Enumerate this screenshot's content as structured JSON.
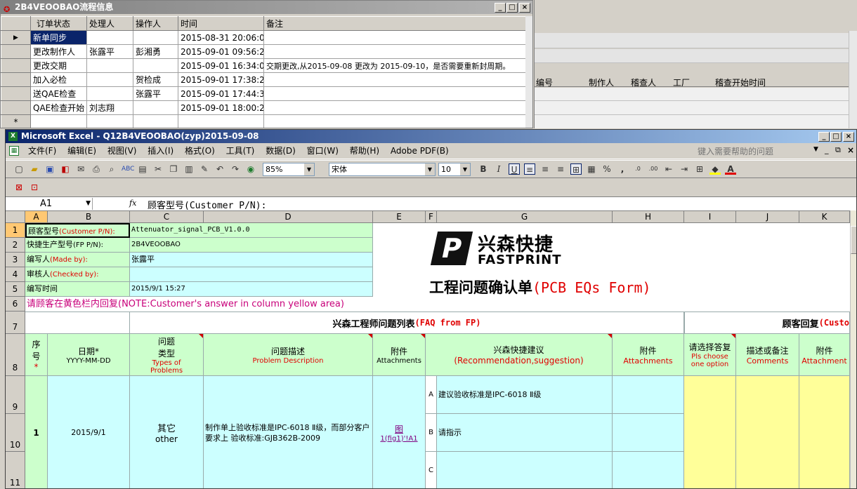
{
  "flow_window": {
    "title": "2B4VEOOBAO流程信息",
    "headers": [
      "订单状态",
      "处理人",
      "操作人",
      "时间",
      "备注"
    ],
    "rows": [
      {
        "status": "新单同步",
        "handler": "",
        "operator": "",
        "time": "2015-08-31 20:06:00",
        "note": ""
      },
      {
        "status": "更改制作人",
        "handler": "张露平",
        "operator": "彭湘勇",
        "time": "2015-09-01 09:56:28",
        "note": ""
      },
      {
        "status": "更改交期",
        "handler": "",
        "operator": "",
        "time": "2015-09-01 16:34:09",
        "note": "交期更改,从2015-09-08 更改为 2015-09-10，是否需要重新封周期。"
      },
      {
        "status": "加入必检",
        "handler": "",
        "operator": "贺检成",
        "time": "2015-09-01 17:38:20",
        "note": ""
      },
      {
        "status": "送QAE检查",
        "handler": "",
        "operator": "张露平",
        "time": "2015-09-01 17:44:38",
        "note": ""
      },
      {
        "status": "QAE检查开始",
        "handler": "刘志翔",
        "operator": "",
        "time": "2015-09-01 18:00:24",
        "note": ""
      }
    ],
    "new_row_marker": "*",
    "current_row_marker": "▶"
  },
  "back_window": {
    "headers": [
      "编号",
      "制作人",
      "稽查人",
      "工厂",
      "稽查开始时间"
    ]
  },
  "excel": {
    "title": "Microsoft Excel - Q12B4VEOOBAO(zyp)2015-09-08",
    "menu": [
      "文件(F)",
      "编辑(E)",
      "视图(V)",
      "插入(I)",
      "格式(O)",
      "工具(T)",
      "数据(D)",
      "窗口(W)",
      "帮助(H)",
      "Adobe PDF(B)"
    ],
    "help_placeholder": "键入需要帮助的问题",
    "zoom": "85%",
    "font": "宋体",
    "font_size": "10",
    "name_box": "A1",
    "fx": "fx",
    "formula": "顾客型号(Customer P/N):",
    "columns": [
      "A",
      "B",
      "C",
      "D",
      "E",
      "F",
      "G",
      "H",
      "I",
      "J",
      "K"
    ],
    "rows": [
      "1",
      "2",
      "3",
      "4",
      "5",
      "6",
      "7",
      "8",
      "9",
      "10",
      "11"
    ],
    "info": [
      {
        "label_cn": "顾客型号",
        "label_en": "(Customer P/N):",
        "value": "Attenuator_signal_PCB_V1.0.0"
      },
      {
        "label_cn": "快捷生产型号",
        "label_en": "(FP P/N):",
        "value": "2B4VEOOBAO"
      },
      {
        "label_cn": "编写人",
        "label_en": "(Made by):",
        "value": "张露平"
      },
      {
        "label_cn": "审核人",
        "label_en": "(Checked by):",
        "value": ""
      },
      {
        "label_cn": "编写时间",
        "label_en": "",
        "value": "2015/9/1 15:27"
      }
    ],
    "note_cn": "请顾客在黄色栏内回复",
    "note_en": "(NOTE:Customer's answer in column yellow area)",
    "logo_cn": "兴森快捷",
    "logo_en": "FASTPRINT",
    "form_title_cn": "工程问题确认单",
    "form_title_en": "(PCB EQs Form)",
    "faq_title_cn": "兴森工程师问题列表",
    "faq_title_en": "(FAQ from FP)",
    "reply_title_cn": "顾客回复",
    "reply_title_en": "(Custo",
    "h_seq": "序号",
    "h_seq_star": "*",
    "h_date": "日期*",
    "h_date_fmt": "YYYY-MM-DD",
    "h_type": "问题类型",
    "h_type_en": "Types of Problems",
    "h_desc": "问题描述",
    "h_desc_en": "Problem Description",
    "h_att": "附件",
    "h_att_en": "Attachments",
    "h_rec": "兴森快捷建议",
    "h_rec_en": "(Recommendation,suggestion)",
    "h_att2": "附件",
    "h_att2_en": "Attachments",
    "h_choose": "请选择答复",
    "h_choose_en": "Pls choose one option",
    "h_comments": "描述或备注",
    "h_comments_en": "Comments",
    "h_att3": "附件",
    "h_att3_en": "Attachment",
    "item": {
      "seq": "1",
      "date": "2015/9/1",
      "type_cn": "其它",
      "type_en": "other",
      "desc": "制作单上验收标准是IPC-6018 Ⅱ级，而部分客户要求上 验收标准:GJB362B-2009",
      "att_link1": "图",
      "att_link2": "1(fig1)'!A1",
      "opt_a": "A",
      "rec_a": "建议验收标准是IPC-6018 Ⅱ级",
      "opt_b": "B",
      "rec_b": "请指示",
      "opt_c": "C"
    }
  }
}
